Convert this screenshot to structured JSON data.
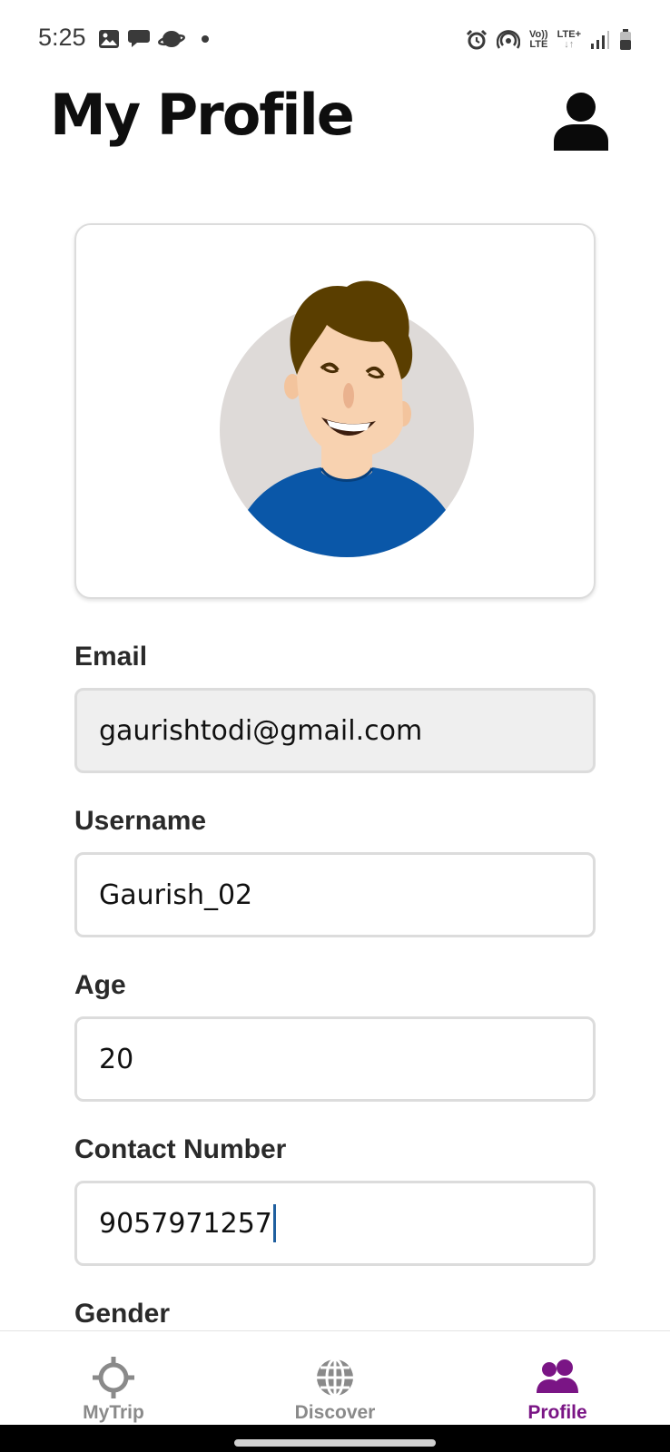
{
  "status_bar": {
    "time": "5:25",
    "left_icons": [
      "image-icon",
      "message-icon",
      "planet-icon",
      "dot-icon"
    ],
    "right_icons": [
      "alarm-icon",
      "hotspot-icon",
      "volte-icon",
      "lte-plus-icon",
      "signal-icon",
      "battery-icon"
    ],
    "volte_top": "Vo))",
    "volte_bottom": "LTE",
    "lte_plus": "LTE+"
  },
  "header": {
    "title": "My Profile",
    "account_icon": "person-icon"
  },
  "avatar": {
    "icon": "avatar-illustration",
    "colors": {
      "background_circle": "#dedad8",
      "hair": "#5a3e00",
      "skin": "#f8d2b0",
      "shirt": "#0a57a8"
    }
  },
  "form": {
    "email_label": "Email",
    "email_value": "gaurishtodi@gmail.com",
    "username_label": "Username",
    "username_value": "Gaurish_02",
    "age_label": "Age",
    "age_value": "20",
    "contact_label": "Contact Number",
    "contact_value": "9057971257",
    "gender_label": "Gender"
  },
  "nav": {
    "items": [
      {
        "label": "MyTrip",
        "icon": "crosshair-icon",
        "active": false
      },
      {
        "label": "Discover",
        "icon": "globe-icon",
        "active": false
      },
      {
        "label": "Profile",
        "icon": "people-icon",
        "active": true
      }
    ],
    "active_color": "#7a1585",
    "inactive_color": "#8a8a8a"
  }
}
